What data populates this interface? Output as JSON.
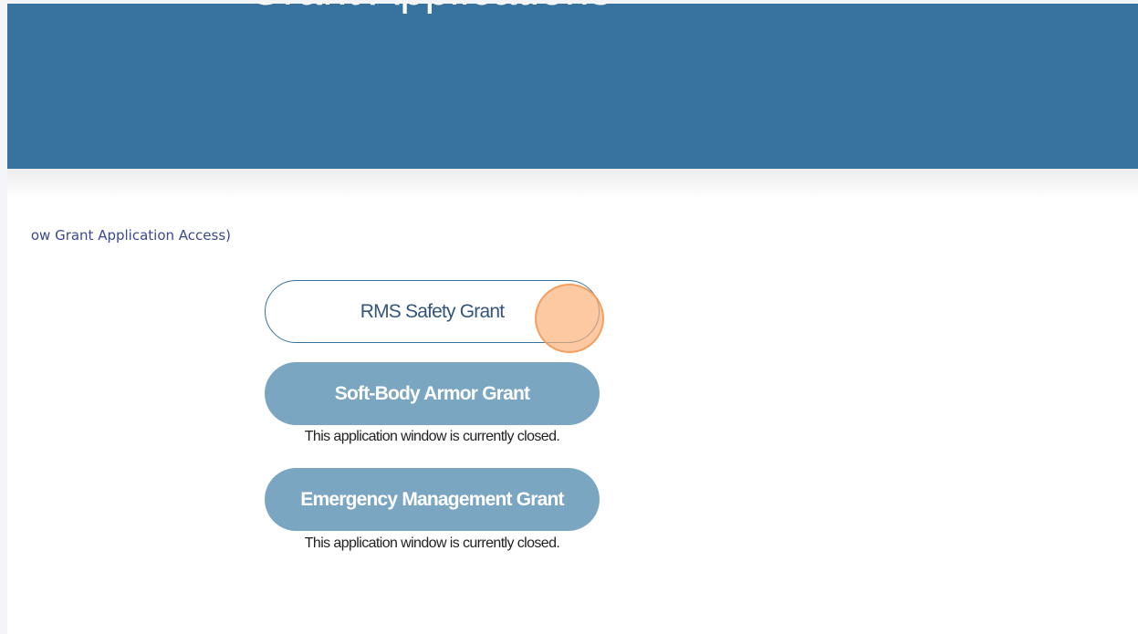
{
  "header": {
    "title": "Grant Applications"
  },
  "access_note": {
    "text": "ow Grant Application Access)"
  },
  "grants": {
    "rms": {
      "label": "RMS Safety Grant"
    },
    "soft_body_armor": {
      "label": "Soft-Body Armor Grant",
      "status": "This application window is currently closed."
    },
    "emergency_management": {
      "label": "Emergency Management Grant",
      "status": "This application window is currently closed."
    }
  },
  "colors": {
    "header_bg": "#37739e",
    "closed_button_bg": "#7aa6c2",
    "open_button_border": "#37739e",
    "click_marker": "#faaf78"
  }
}
